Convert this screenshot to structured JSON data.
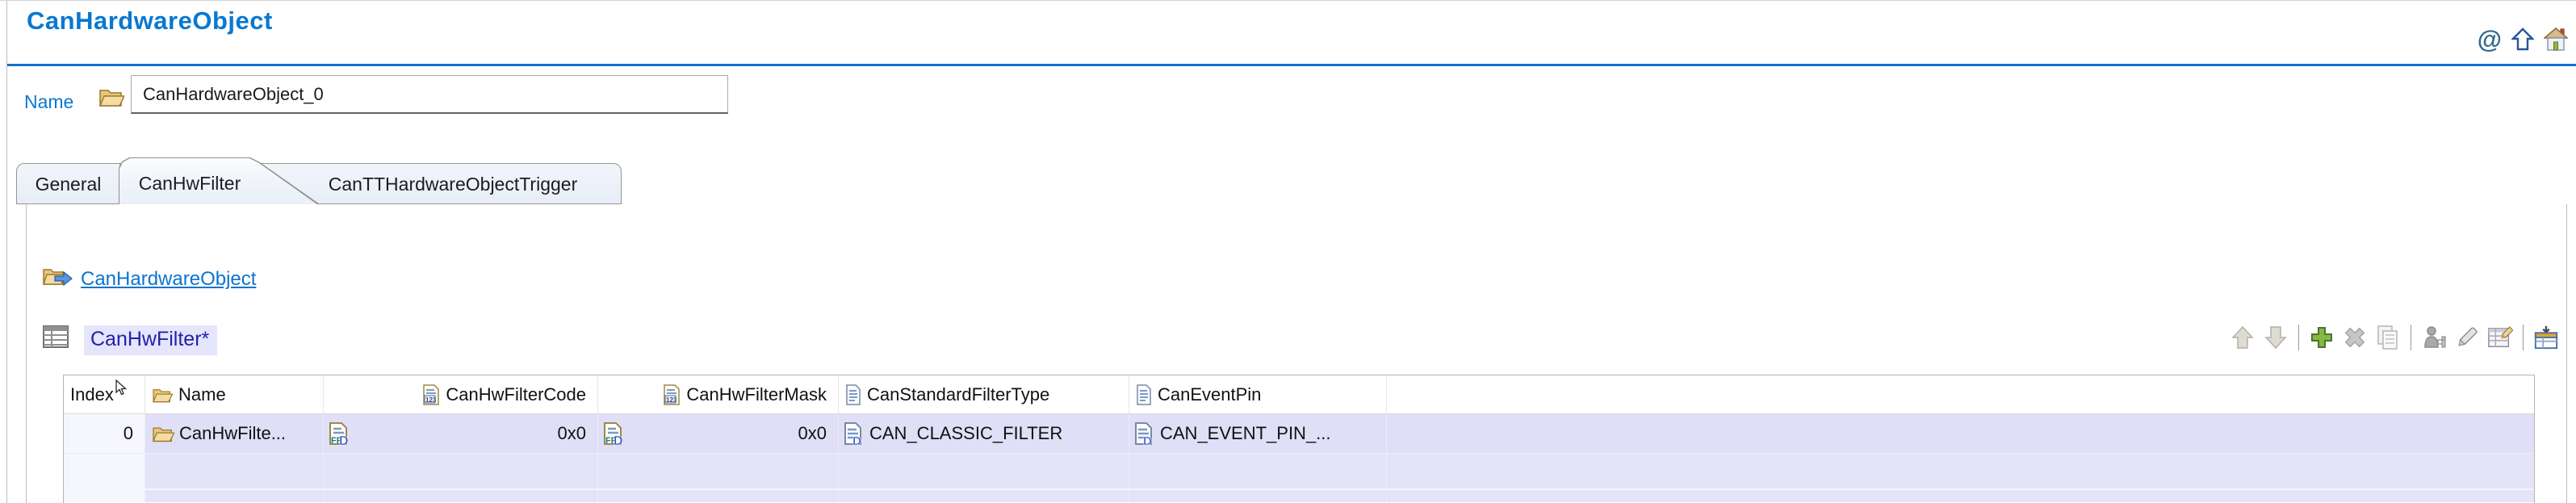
{
  "header": {
    "title": "CanHardwareObject",
    "icons": [
      "at-icon",
      "up-arrow-icon",
      "home-icon"
    ]
  },
  "name_field": {
    "label": "Name",
    "value": "CanHardwareObject_0"
  },
  "tabs": [
    {
      "label": "General",
      "selected": false
    },
    {
      "label": "CanHwFilter",
      "selected": true
    },
    {
      "label": "CanTTHardwareObjectTrigger",
      "selected": false
    }
  ],
  "content": {
    "breadcrumb_link": "CanHardwareObject",
    "list_label": "CanHwFilter*",
    "toolbar": [
      "move-up-icon",
      "move-down-icon",
      "add-icon",
      "delete-icon",
      "copy-icon",
      "add-person-icon",
      "edit-icon",
      "table-edit-icon",
      "table-import-icon"
    ],
    "table": {
      "columns": [
        {
          "label": "Index",
          "icon": ""
        },
        {
          "label": "Name",
          "icon": "folder-icon"
        },
        {
          "label": "CanHwFilterCode",
          "icon": "numeric-doc-icon"
        },
        {
          "label": "CanHwFilterMask",
          "icon": "numeric-doc-icon"
        },
        {
          "label": "CanStandardFilterType",
          "icon": "enum-doc-icon"
        },
        {
          "label": "CanEventPin",
          "icon": "enum-doc-icon"
        }
      ],
      "rows": [
        {
          "cells": [
            "0",
            "CanHwFilte...",
            "0x0",
            "0x0",
            "CAN_CLASSIC_FILTER",
            "CAN_EVENT_PIN_..."
          ]
        }
      ]
    }
  },
  "colors": {
    "accent_blue": "#0a78d0",
    "rule_blue": "#1371cd",
    "link_blue": "#0b74d0",
    "label_navy": "#2222aa",
    "selection_lavender": "#dfdff7",
    "index_column": "#f6f6fd",
    "tab_fill": "#e9eff8",
    "add_green": "#86b944"
  }
}
